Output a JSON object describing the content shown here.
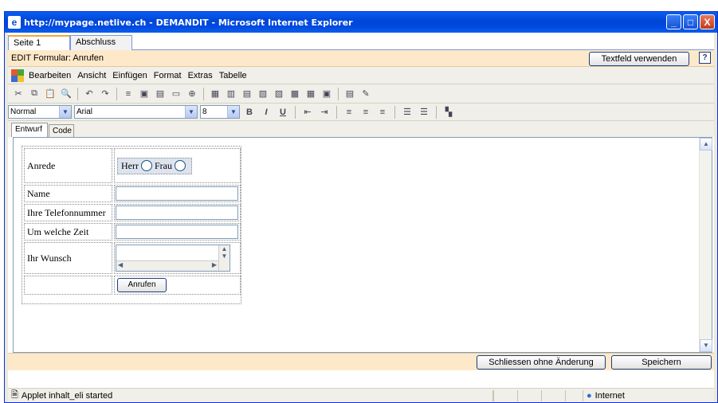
{
  "window": {
    "title": "http://mypage.netlive.ch - DEMANDIT - Microsoft Internet Explorer",
    "controls": {
      "minimize": "_",
      "maximize": "□",
      "close": "X"
    }
  },
  "tabs": [
    {
      "label": "Seite 1"
    },
    {
      "label": "Abschluss"
    }
  ],
  "editbar": {
    "title": "EDIT Formular: Anrufen",
    "textfield_button": "Textfeld verwenden",
    "help": "?"
  },
  "menubar": {
    "items": [
      "Bearbeiten",
      "Ansicht",
      "Einfügen",
      "Format",
      "Extras",
      "Tabelle"
    ]
  },
  "formatbar": {
    "style": "Normal",
    "font": "Arial",
    "size": "8",
    "bold": "B",
    "italic": "I",
    "underline": "U"
  },
  "subtabs": [
    {
      "label": "Entwurf"
    },
    {
      "label": "Code"
    }
  ],
  "form": {
    "anrede_label": "Anrede",
    "herr_label": "Herr",
    "frau_label": "Frau",
    "name_label": "Name",
    "telefon_label": "Ihre Telefonnummer",
    "zeit_label": "Um welche Zeit",
    "wunsch_label": "Ihr Wunsch",
    "submit_label": "Anrufen"
  },
  "footer": {
    "close_without_change": "Schliessen ohne Änderung",
    "save": "Speichern"
  },
  "status": {
    "text": "Applet inhalt_eli started",
    "zone": "Internet"
  },
  "colors": {
    "accent_orange": "#fde9c9",
    "titlebar_blue": "#0047d6"
  }
}
